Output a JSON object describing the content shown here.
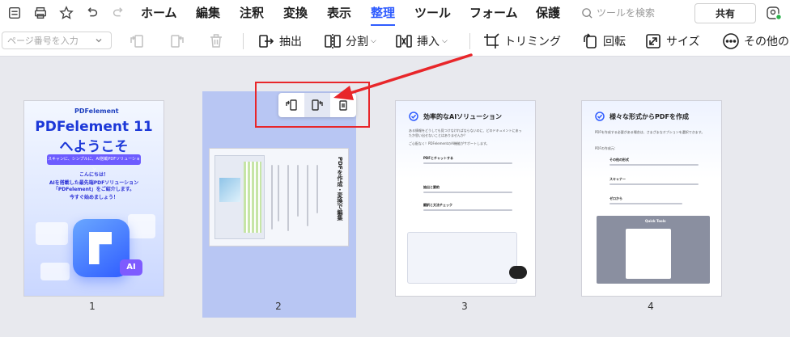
{
  "menu": {
    "items": [
      {
        "label": "ホーム",
        "active": false
      },
      {
        "label": "編集",
        "active": false
      },
      {
        "label": "注釈",
        "active": false
      },
      {
        "label": "変換",
        "active": false
      },
      {
        "label": "表示",
        "active": false
      },
      {
        "label": "整理",
        "active": true
      },
      {
        "label": "ツール",
        "active": false
      },
      {
        "label": "フォーム",
        "active": false
      },
      {
        "label": "保護",
        "active": false
      }
    ],
    "search_placeholder": "ツールを検索",
    "share_label": "共有"
  },
  "toolbar": {
    "page_input_placeholder": "ページ番号を入力",
    "extract_label": "抽出",
    "split_label": "分割",
    "insert_label": "挿入",
    "crop_label": "トリミング",
    "rotate_label": "回転",
    "size_label": "サイズ",
    "other_label": "その他の"
  },
  "pages": {
    "p1": {
      "number": "1",
      "brand": "PDFelement",
      "title1": "PDFelement 11",
      "title2": "へようこそ",
      "pill_text": "スキャンに、シンプルに、AI搭載PDFソリューション",
      "greeting": "こんにちは！",
      "line1": "AIを搭載した最先端PDFソリューション",
      "line2": "「PDFelement」をご紹介します。",
      "line3": "今すぐ始めましょう！",
      "ai_badge": "AI"
    },
    "p2": {
      "number": "2",
      "heading": "PDFを作成・変換で編集"
    },
    "p3": {
      "number": "3",
      "title": "効率的なAIソリューション",
      "intro": "ある情報をどうしても見つけなければならないのに、どのドキュメントにあったか思い出せないことはありませんか？",
      "support": "ご心配なく！PDFelementのAI機能がサポートします。",
      "item1_title": "PDFとチャットする",
      "item2_title": "抽出と要約",
      "item3_title": "翻訳と文法チェック"
    },
    "p4": {
      "number": "4",
      "title": "様々な形式からPDFを作成",
      "intro": "PDFを作成する必要がある場合は、さまざまなオプションを選択できます。",
      "sub": "PDFの作成元：",
      "item1": "その他の形式",
      "item2": "スキャナー",
      "item3": "ゼロから",
      "quick_tools": "Quick Tools"
    }
  },
  "mini_toolbar": {
    "icons": [
      "rotate-left-icon",
      "rotate-right-icon",
      "delete-icon"
    ]
  },
  "colors": {
    "accent": "#2f5cff",
    "selection": "#b8c6f3",
    "annotation": "#e8262a"
  }
}
